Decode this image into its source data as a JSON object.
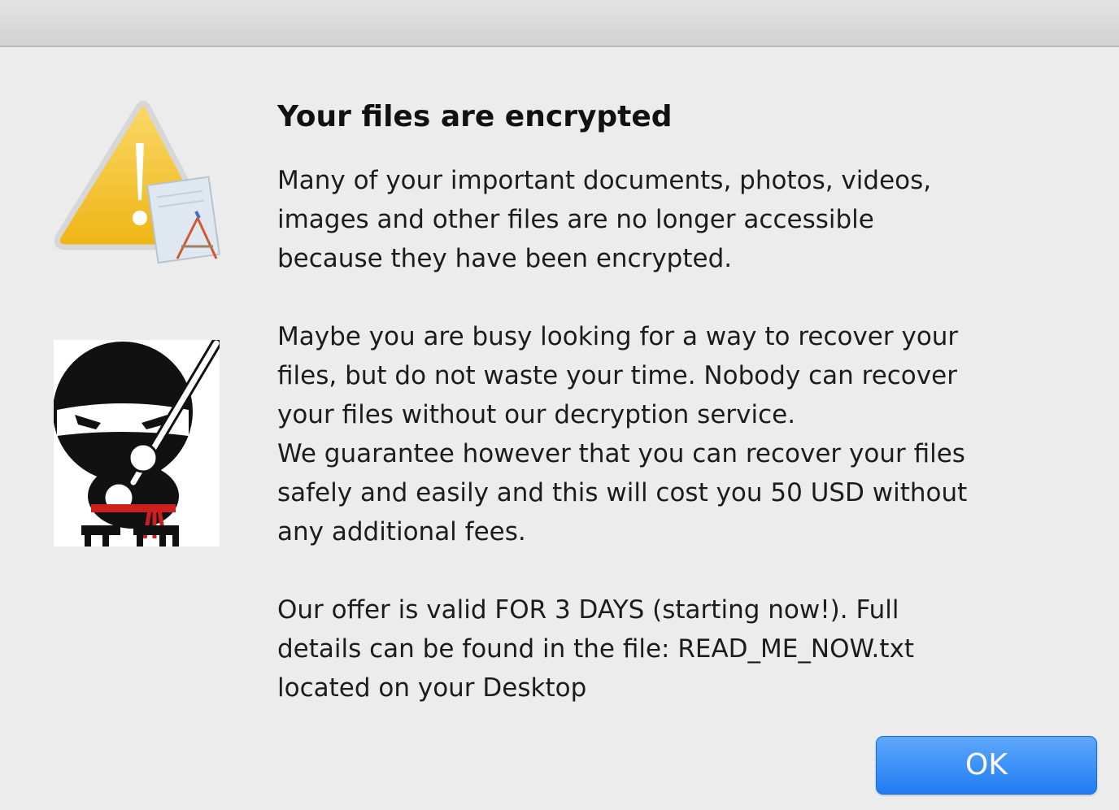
{
  "dialog": {
    "title": "Your files are encrypted",
    "paragraphs": [
      "Many of your important documents, photos, videos,\nimages and other files are no longer accessible\nbecause they have been encrypted.",
      "Maybe you are busy looking for a way to recover your\nfiles, but do not waste your time. Nobody can recover\nyour files without our decryption service.\nWe guarantee however that you can recover your files\nsafely and easily and this will cost you 50 USD without\nany additional fees.",
      "Our offer is valid FOR 3 DAYS (starting now!). Full\ndetails can be found in the file:  READ_ME_NOW.txt\nlocated on your Desktop"
    ],
    "ok_label": "OK"
  },
  "icons": {
    "warning": "warning-icon",
    "ninja": "ninja-image"
  },
  "colors": {
    "background": "#ececec",
    "button": "#1f7cf3",
    "warning_yellow": "#f3c11f",
    "sash_red": "#cc1f1f"
  }
}
